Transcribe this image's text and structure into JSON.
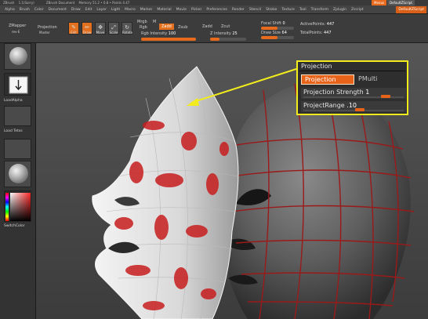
{
  "titlebar": {
    "app": "ZBrush",
    "version": "1.1(Sorry)",
    "document": "ZBrush Document",
    "stats": "Memory 51.2 • 0.8 • Points 4.47",
    "quicksave": "Menus",
    "default_script": "DefaultZScript"
  },
  "menubar": {
    "items": [
      "Alpha",
      "Brush",
      "Color",
      "Document",
      "Draw",
      "Edit",
      "Layer",
      "Light",
      "Macro",
      "Marker",
      "Material",
      "Movie",
      "Picker",
      "Preferences",
      "Render",
      "Stencil",
      "Stroke",
      "Texture",
      "Tool",
      "Transform",
      "Zplugin",
      "Zscript"
    ],
    "macro_label": "DefaultZScript"
  },
  "shelf": {
    "zmapper_label": "ZMapper",
    "zmapper_sub": "rev-E",
    "projection_label": "Projection",
    "projection_sub": "Master",
    "edit_label": "Edit",
    "draw_label": "Draw",
    "move_label": "Move",
    "scale_label": "Scale",
    "rotate_label": "Rotate",
    "rgb_label": "Rgb",
    "m_label": "M",
    "mrgb_label": "Mrgb",
    "zadd_label": "Zadd",
    "zsub_label": "Zsub",
    "zcut_label": "Zcut",
    "zadd_value": "Zadd",
    "rgb_intensity_label": "Rgb Intensity",
    "rgb_intensity_value": "100",
    "z_intensity_label": "Z Intensity",
    "z_intensity_value": "25",
    "focal_shift_label": "Focal Shift",
    "focal_shift_value": "0",
    "draw_size_label": "Draw Size",
    "draw_size_value": "64",
    "active_points_label": "ActivePoints:",
    "active_points_value": "447",
    "total_points_label": "TotalPoints:",
    "total_points_value": "447"
  },
  "lefttray": {
    "load_alpha_label": "LoadAlpha",
    "load_texture_label": "Load Tetxs",
    "switch_color_label": "SwitchColor"
  },
  "projection_panel": {
    "title": "Projection",
    "projection_button": "Projection",
    "pmulti_label": "PMulti",
    "strength_label": "Projection Strength",
    "strength_value": "1",
    "strength_level": 0.82,
    "range_label": "ProjectRange",
    "range_value": ".10",
    "range_level": 0.56
  },
  "colors": {
    "accent": "#e8631a",
    "callout": "#f2ec1c",
    "mesh_highlight": "#c81e1e"
  }
}
